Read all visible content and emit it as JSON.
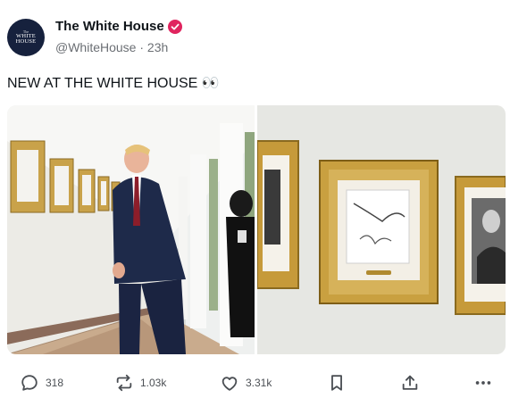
{
  "author": {
    "name": "The White House",
    "meta": "@WhiteHouse · 23h",
    "avatar_lines": [
      "The",
      "WHITE",
      "HOUSE"
    ]
  },
  "post": {
    "text": "NEW AT THE WHITE HOUSE 👀"
  },
  "actions": {
    "replies": "318",
    "reposts": "1.03k",
    "likes": "3.31k"
  },
  "colors": {
    "verified_badge": "#e0245e",
    "icon_gray": "#4b4f54"
  },
  "icons": [
    "reply-icon",
    "repost-icon",
    "heart-icon",
    "bookmark-icon",
    "share-icon",
    "more-icon"
  ]
}
